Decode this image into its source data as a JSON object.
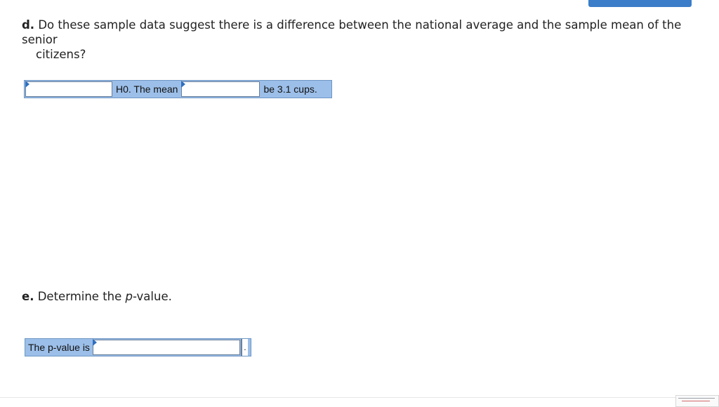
{
  "question_d": {
    "label": "d.",
    "text": "Do these sample data suggest there is a difference between the national average and the sample mean of the senior",
    "text_cont": "citizens?"
  },
  "hypothesis_row": {
    "h0_text": "H0. The mean",
    "suffix_text": "be 3.1 cups."
  },
  "question_e": {
    "label": "e.",
    "text_before": "Determine the ",
    "text_italic": "p",
    "text_after": "-value."
  },
  "pvalue_row": {
    "label": "The p-value is",
    "value": "",
    "period": "."
  }
}
